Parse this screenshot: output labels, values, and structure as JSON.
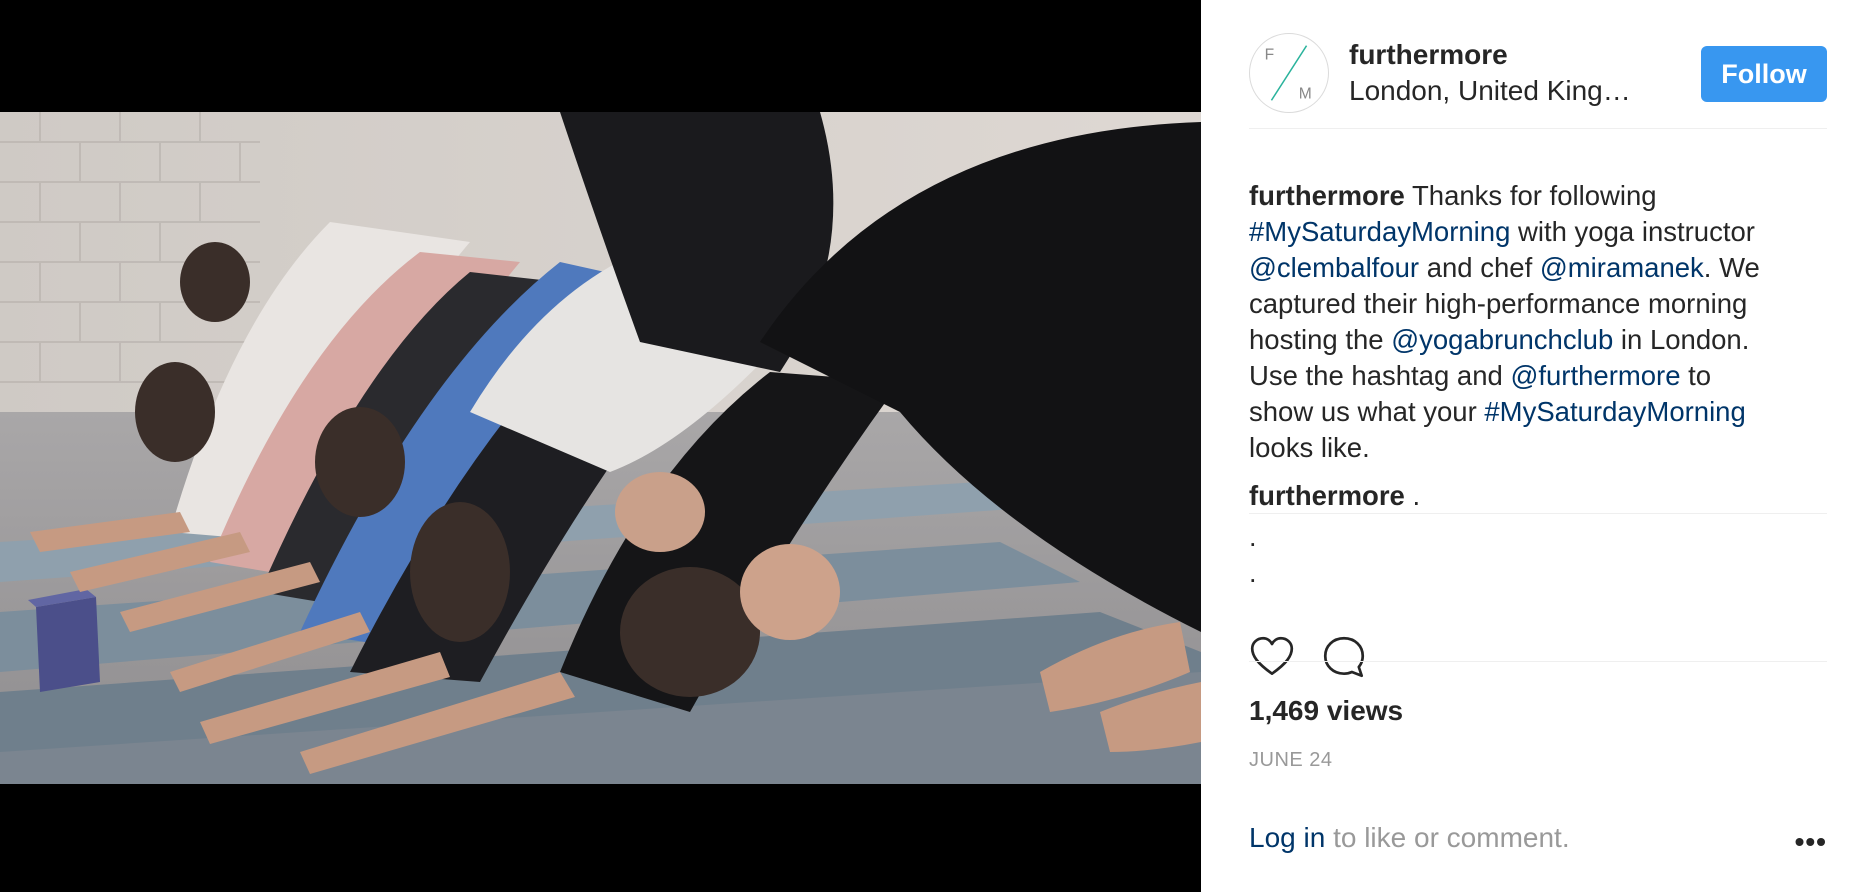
{
  "post": {
    "username": "furthermore",
    "location": "London, United King…",
    "follow_label": "Follow",
    "avatar_letters": {
      "top": "F",
      "bottom": "M"
    }
  },
  "caption": {
    "author": "furthermore",
    "lines": [
      {
        "parts": [
          {
            "text": " Thanks for following",
            "link": false
          }
        ]
      },
      {
        "parts": [
          {
            "text": "#MySaturdayMorning",
            "link": true
          },
          {
            "text": " with yoga instructor",
            "link": false
          }
        ]
      },
      {
        "parts": [
          {
            "text": "@clembalfour",
            "link": true
          },
          {
            "text": " and chef ",
            "link": false
          },
          {
            "text": "@miramanek",
            "link": true
          },
          {
            "text": ". We",
            "link": false
          }
        ]
      },
      {
        "parts": [
          {
            "text": "captured their high-performance morning",
            "link": false
          }
        ]
      },
      {
        "parts": [
          {
            "text": "hosting the ",
            "link": false
          },
          {
            "text": "@yogabrunchclub",
            "link": true
          },
          {
            "text": " in London.",
            "link": false
          }
        ]
      },
      {
        "parts": [
          {
            "text": "Use the hashtag and ",
            "link": false
          },
          {
            "text": "@furthermore",
            "link": true
          },
          {
            "text": " to",
            "link": false
          }
        ]
      },
      {
        "parts": [
          {
            "text": "show us what your ",
            "link": false
          },
          {
            "text": "#MySaturdayMorning",
            "link": true
          }
        ]
      },
      {
        "parts": [
          {
            "text": "looks like.",
            "link": false
          }
        ]
      }
    ]
  },
  "comment": {
    "author": "furthermore",
    "text": " .",
    "dot_lines": [
      ".",
      "."
    ]
  },
  "actions": {
    "like_icon": "heart-outline-icon",
    "comment_icon": "speech-bubble-icon"
  },
  "stats": {
    "views": "1,469 views",
    "date": "JUNE 24"
  },
  "footer": {
    "login_link": "Log in",
    "login_suffix": " to like or comment.",
    "more_label": "•••"
  },
  "colors": {
    "accent": "#3897f0",
    "link": "#003569",
    "muted": "#999999",
    "divider": "#efefef"
  }
}
